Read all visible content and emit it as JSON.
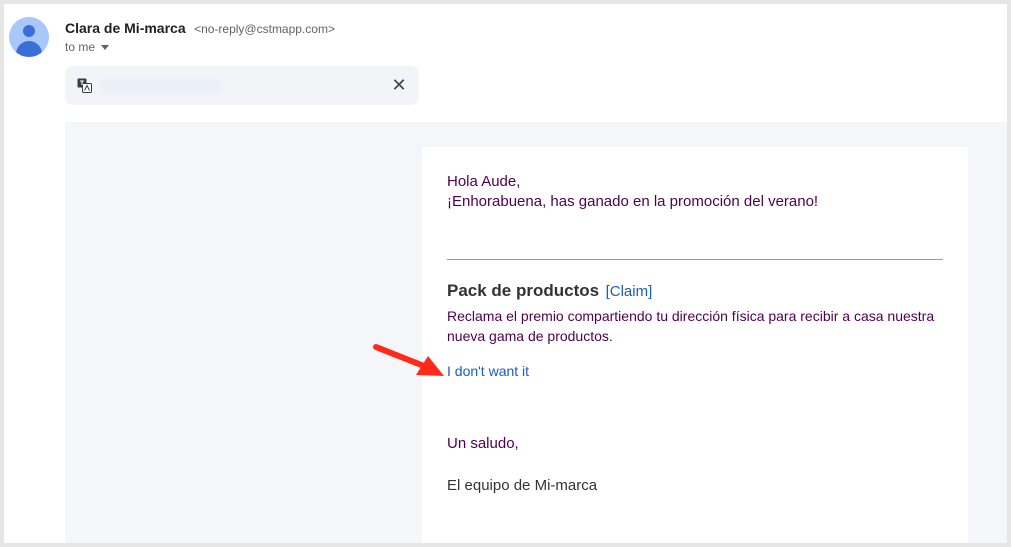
{
  "header": {
    "sender_name": "Clara de Mi-marca",
    "sender_email": "<no-reply@cstmapp.com>",
    "recipient": "to me"
  },
  "translate_bar": {
    "icon": "translate-icon",
    "close_symbol": "✕"
  },
  "email": {
    "greeting": "Hola Aude,",
    "congrats": "¡Enhorabuena, has ganado en la promoción del verano!",
    "pack_title": "Pack de productos",
    "claim_link": "[Claim]",
    "pack_description": "Reclama el premio compartiendo tu dirección física para recibir a casa nuestra nueva gama de productos.",
    "decline_link": "I don't want it",
    "sign_off": "Un saludo,",
    "signature": "El equipo de Mi-marca"
  },
  "colors": {
    "accent_text": "#500050",
    "link": "#1a5cc4",
    "annotation_arrow": "#ff2a1a"
  }
}
